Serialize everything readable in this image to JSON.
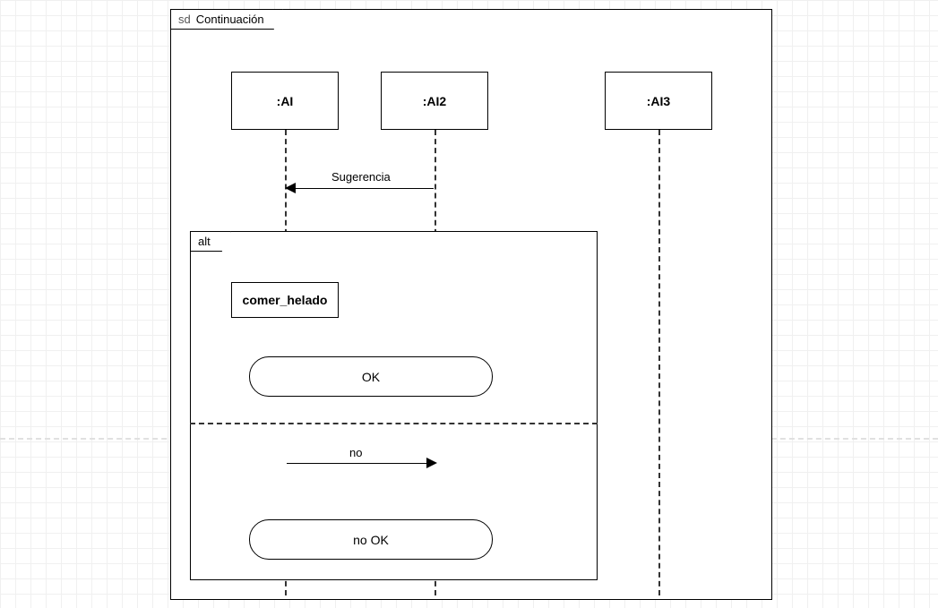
{
  "frame": {
    "keyword": "sd",
    "title": "Continuación"
  },
  "lifelines": {
    "l1": ":AI",
    "l2": ":AI2",
    "l3": ":AI3"
  },
  "messages": {
    "sugerencia": "Sugerencia",
    "no": "no"
  },
  "alt": {
    "keyword": "alt",
    "invariant": "comer_helado",
    "continuation_ok": "OK",
    "continuation_no_ok": "no OK"
  }
}
